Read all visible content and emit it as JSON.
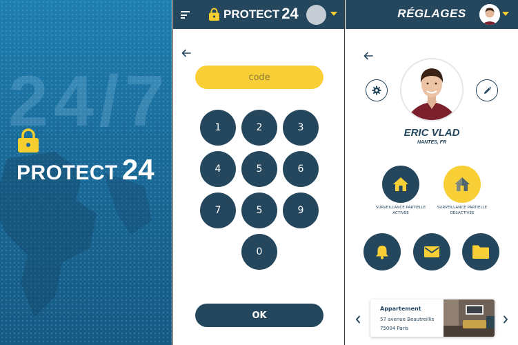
{
  "splash": {
    "background_text": "24/7",
    "brand_word": "PROTECT",
    "brand_number": "24"
  },
  "code_screen": {
    "header": {
      "brand_word": "PROTECT",
      "brand_number": "24"
    },
    "code_placeholder": "code",
    "keys": [
      "1",
      "2",
      "3",
      "4",
      "5",
      "6",
      "7",
      "5",
      "9",
      "0"
    ],
    "ok_label": "OK"
  },
  "settings": {
    "title": "RÉGLAGES",
    "user_name": "ERIC VLAD",
    "user_location": "NANTES, FR",
    "modes": [
      {
        "label": "Surveillance partielle activée",
        "state": "active"
      },
      {
        "label": "Surveillance partielle désactivée",
        "state": "inactive"
      }
    ],
    "actions": [
      "bell-icon",
      "mail-icon",
      "folder-icon"
    ],
    "property": {
      "title": "Appartement",
      "address_line1": "57 avenue Beautreillis",
      "address_line2": "75004 Paris"
    }
  },
  "colors": {
    "navy": "#25475e",
    "yellow": "#f8cf37",
    "splash_blue": "#1a6a98"
  }
}
